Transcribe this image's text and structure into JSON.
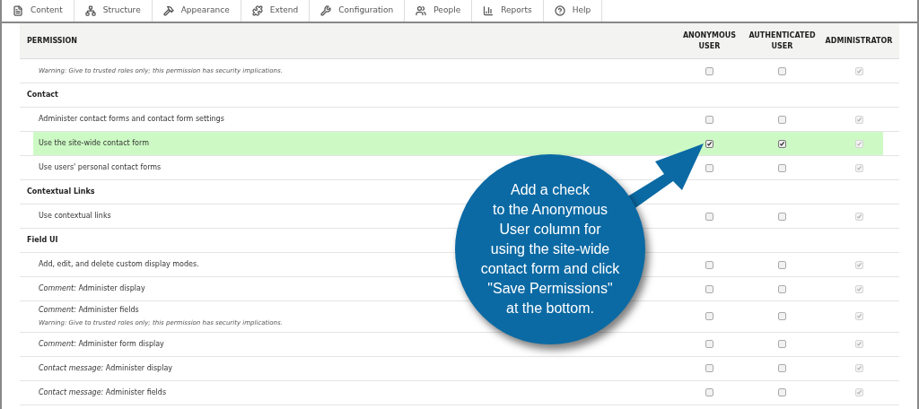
{
  "toolbar": [
    {
      "label": "Content",
      "kind": "content"
    },
    {
      "label": "Structure",
      "kind": "structure"
    },
    {
      "label": "Appearance",
      "kind": "appearance"
    },
    {
      "label": "Extend",
      "kind": "extend"
    },
    {
      "label": "Configuration",
      "kind": "configuration"
    },
    {
      "label": "People",
      "kind": "people"
    },
    {
      "label": "Reports",
      "kind": "reports"
    },
    {
      "label": "Help",
      "kind": "help"
    }
  ],
  "table": {
    "columns": [
      "PERMISSION",
      "ANONYMOUS USER",
      "AUTHENTICATED USER",
      "ADMINISTRATOR"
    ],
    "rows": [
      {
        "kind": "permission",
        "warning": "Warning: Give to trusted roles only; this permission has security implications.",
        "highlighted": false,
        "checks": [
          {
            "checked": false,
            "disabled": false
          },
          {
            "checked": false,
            "disabled": false
          },
          {
            "checked": true,
            "disabled": true
          }
        ]
      },
      {
        "kind": "module",
        "label": "Contact"
      },
      {
        "kind": "permission",
        "label": "Administer contact forms and contact form settings",
        "highlighted": false,
        "checks": [
          {
            "checked": false,
            "disabled": false
          },
          {
            "checked": false,
            "disabled": false
          },
          {
            "checked": true,
            "disabled": true
          }
        ]
      },
      {
        "kind": "permission",
        "label": "Use the site-wide contact form",
        "highlighted": true,
        "checks": [
          {
            "checked": true,
            "disabled": false
          },
          {
            "checked": true,
            "disabled": false
          },
          {
            "checked": true,
            "disabled": true
          }
        ]
      },
      {
        "kind": "permission",
        "label": "Use users' personal contact forms",
        "highlighted": false,
        "checks": [
          {
            "checked": false,
            "disabled": false
          },
          {
            "checked": false,
            "disabled": false
          },
          {
            "checked": true,
            "disabled": true
          }
        ]
      },
      {
        "kind": "module",
        "label": "Contextual Links"
      },
      {
        "kind": "permission",
        "label": "Use contextual links",
        "highlighted": false,
        "checks": [
          {
            "checked": false,
            "disabled": false
          },
          {
            "checked": false,
            "disabled": false
          },
          {
            "checked": true,
            "disabled": true
          }
        ]
      },
      {
        "kind": "module",
        "label": "Field UI"
      },
      {
        "kind": "permission",
        "label": "Add, edit, and delete custom display modes.",
        "highlighted": false,
        "checks": [
          {
            "checked": false,
            "disabled": false
          },
          {
            "checked": false,
            "disabled": false
          },
          {
            "checked": true,
            "disabled": true
          }
        ]
      },
      {
        "kind": "permission",
        "label": "*Comment:* Administer display",
        "highlighted": false,
        "checks": [
          {
            "checked": false,
            "disabled": false
          },
          {
            "checked": false,
            "disabled": false
          },
          {
            "checked": true,
            "disabled": true
          }
        ]
      },
      {
        "kind": "permission",
        "label": "*Comment:* Administer fields",
        "warning": "Warning: Give to trusted roles only; this permission has security implications.",
        "highlighted": false,
        "checks": [
          {
            "checked": false,
            "disabled": false
          },
          {
            "checked": false,
            "disabled": false
          },
          {
            "checked": true,
            "disabled": true
          }
        ]
      },
      {
        "kind": "permission",
        "label": "*Comment:* Administer form display",
        "highlighted": false,
        "checks": [
          {
            "checked": false,
            "disabled": false
          },
          {
            "checked": false,
            "disabled": false
          },
          {
            "checked": true,
            "disabled": true
          }
        ]
      },
      {
        "kind": "permission",
        "label": "*Contact message:* Administer display",
        "highlighted": false,
        "checks": [
          {
            "checked": false,
            "disabled": false
          },
          {
            "checked": false,
            "disabled": false
          },
          {
            "checked": true,
            "disabled": true
          }
        ]
      },
      {
        "kind": "permission",
        "label": "*Contact message:* Administer fields",
        "highlighted": false,
        "checks": [
          {
            "checked": false,
            "disabled": false
          },
          {
            "checked": false,
            "disabled": false
          },
          {
            "checked": true,
            "disabled": true
          }
        ]
      }
    ]
  },
  "callout": {
    "lines": [
      "Add a check",
      "to the Anonymous",
      "User column for",
      "using the site-wide",
      "contact form and click",
      "\"Save Permissions\"",
      "at the bottom."
    ]
  }
}
